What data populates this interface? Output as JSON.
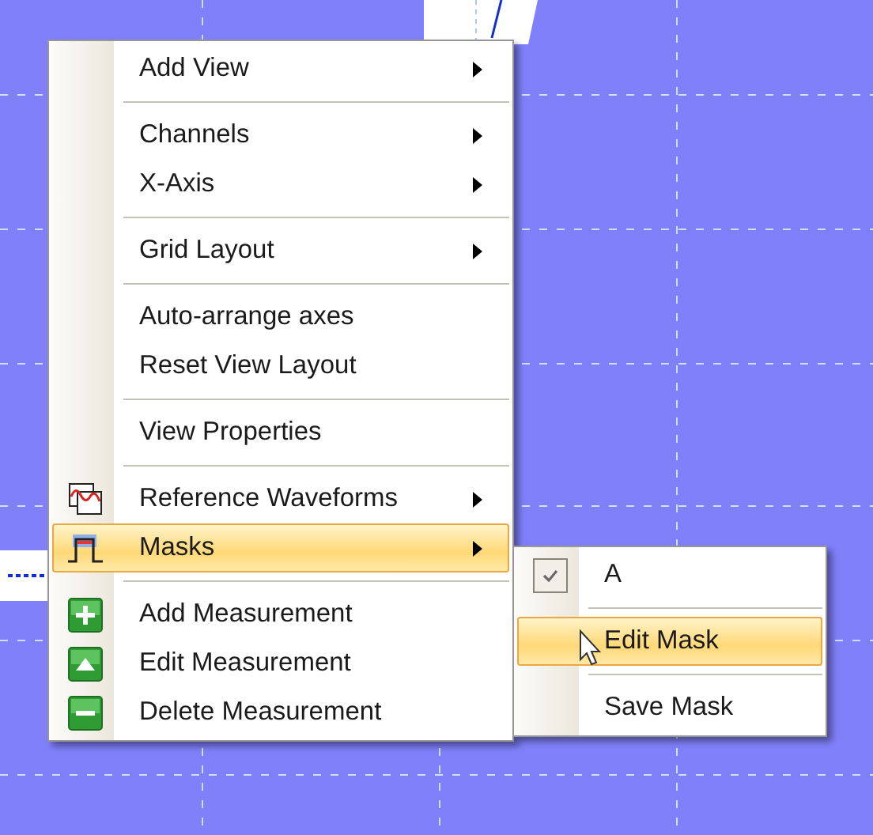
{
  "menu": {
    "items": [
      {
        "kind": "item",
        "label": "Add View",
        "submenu": true,
        "selected": false
      },
      {
        "kind": "separator"
      },
      {
        "kind": "item",
        "label": "Channels",
        "submenu": true,
        "selected": false
      },
      {
        "kind": "item",
        "label": "X-Axis",
        "submenu": true,
        "selected": false
      },
      {
        "kind": "separator"
      },
      {
        "kind": "item",
        "label": "Grid Layout",
        "submenu": true,
        "selected": false
      },
      {
        "kind": "separator"
      },
      {
        "kind": "item",
        "label": "Auto-arrange axes",
        "submenu": false,
        "selected": false
      },
      {
        "kind": "item",
        "label": "Reset View Layout",
        "submenu": false,
        "selected": false
      },
      {
        "kind": "separator"
      },
      {
        "kind": "item",
        "label": "View Properties",
        "submenu": false,
        "selected": false
      },
      {
        "kind": "separator"
      },
      {
        "kind": "item",
        "label": "Reference Waveforms",
        "submenu": true,
        "selected": false
      },
      {
        "kind": "item",
        "label": "Masks",
        "submenu": true,
        "selected": true
      },
      {
        "kind": "separator"
      },
      {
        "kind": "item",
        "label": "Add Measurement",
        "submenu": false,
        "selected": false
      },
      {
        "kind": "item",
        "label": "Edit Measurement",
        "submenu": false,
        "selected": false
      },
      {
        "kind": "item",
        "label": "Delete Measurement",
        "submenu": false,
        "selected": false
      }
    ]
  },
  "submenu": {
    "items": [
      {
        "kind": "check",
        "label": "A",
        "checked": true,
        "selected": false
      },
      {
        "kind": "separator"
      },
      {
        "kind": "item",
        "label": "Edit Mask",
        "selected": true
      },
      {
        "kind": "separator"
      },
      {
        "kind": "item",
        "label": "Save Mask",
        "selected": false
      }
    ]
  }
}
